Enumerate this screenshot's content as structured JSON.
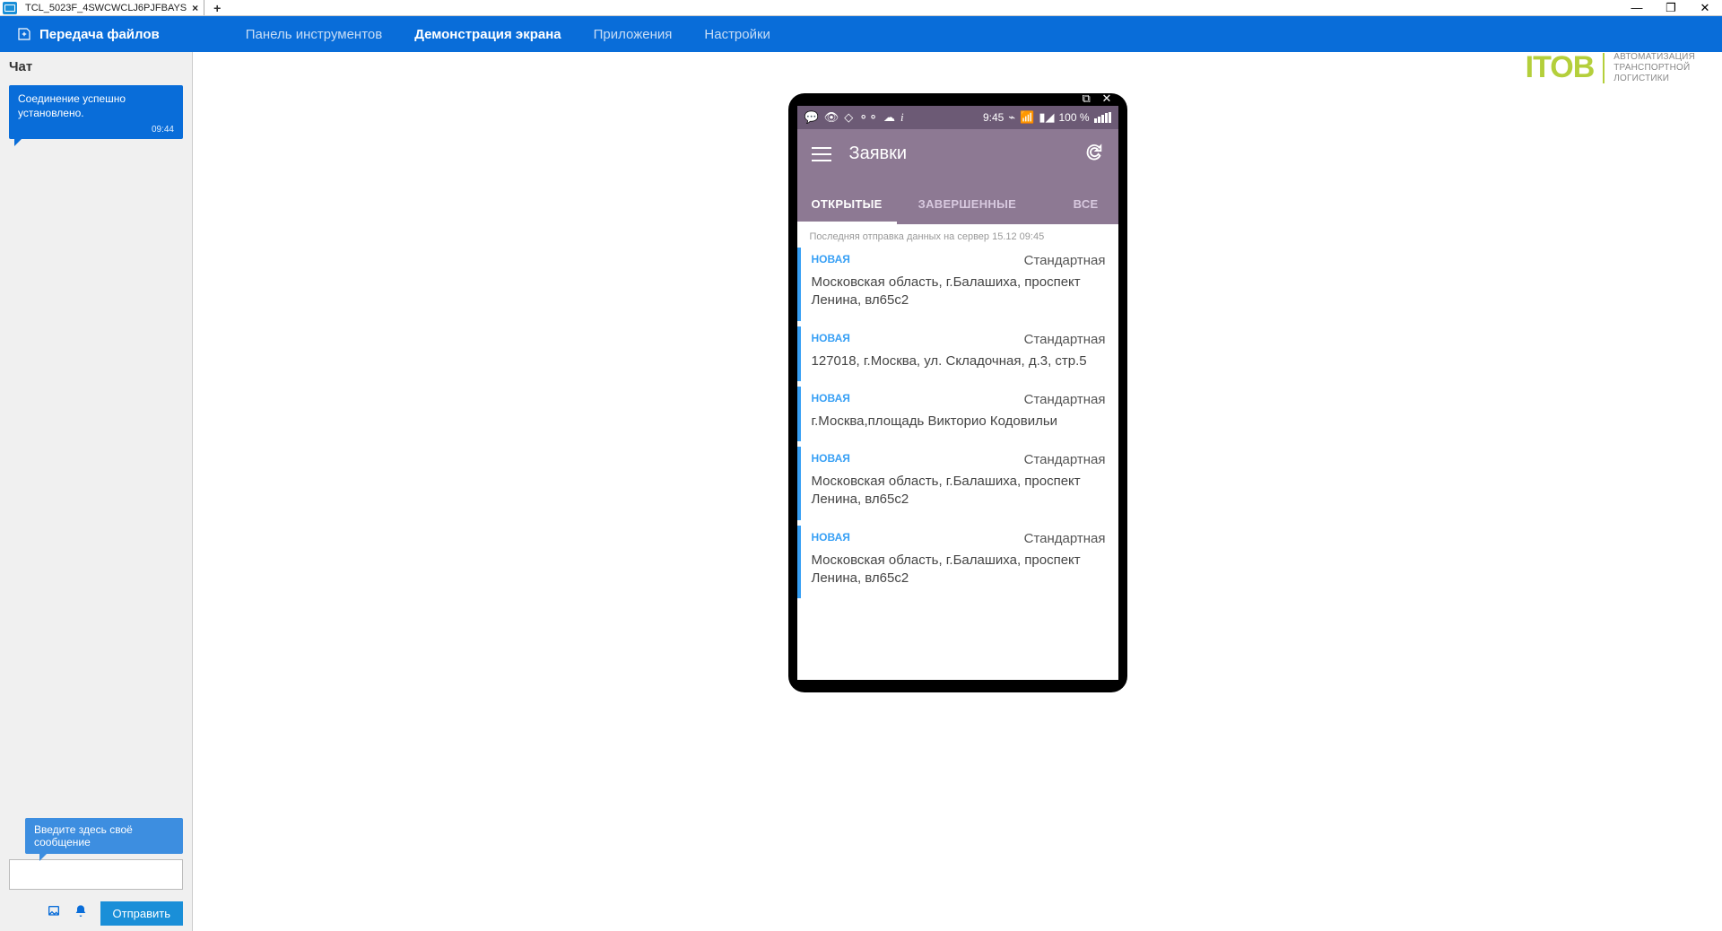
{
  "tab": {
    "title": "TCL_5023F_4SWCWCLJ6PJFBAYS"
  },
  "topbar": {
    "file_transfer": "Передача файлов",
    "tabs": [
      "Панель инструментов",
      "Демонстрация экрана",
      "Приложения",
      "Настройки"
    ],
    "active_index": 1
  },
  "chat": {
    "header": "Чат",
    "message_text": "Соединение успешно установлено.",
    "message_time": "09:44",
    "input_placeholder_tip": "Введите здесь своё сообщение",
    "send_label": "Отправить"
  },
  "logo": {
    "brand": "ITOB",
    "line1": "АВТОМАТИЗАЦИЯ",
    "line2": "ТРАНСПОРТНОЙ",
    "line3": "ЛОГИСТИКИ"
  },
  "phone": {
    "status": {
      "time": "9:45",
      "battery": "100 %"
    },
    "app_title": "Заявки",
    "tabs": [
      "ОТКРЫТЫЕ",
      "ЗАВЕРШЕННЫЕ",
      "ВСЕ"
    ],
    "active_tab_index": 0,
    "sync_line": "Последняя отправка данных на сервер 15.12 09:45",
    "items": [
      {
        "status": "НОВАЯ",
        "type": "Стандартная",
        "addr": "Московская область, г.Балашиха, проспект Ленина, вл65с2"
      },
      {
        "status": "НОВАЯ",
        "type": "Стандартная",
        "addr": "127018, г.Москва, ул. Складочная, д.3, стр.5"
      },
      {
        "status": "НОВАЯ",
        "type": "Стандартная",
        "addr": "г.Москва,площадь Викторио Кодовильи"
      },
      {
        "status": "НОВАЯ",
        "type": "Стандартная",
        "addr": "Московская область, г.Балашиха, проспект Ленина, вл65с2"
      },
      {
        "status": "НОВАЯ",
        "type": "Стандартная",
        "addr": "Московская область, г.Балашиха, проспект Ленина, вл65с2"
      }
    ]
  }
}
